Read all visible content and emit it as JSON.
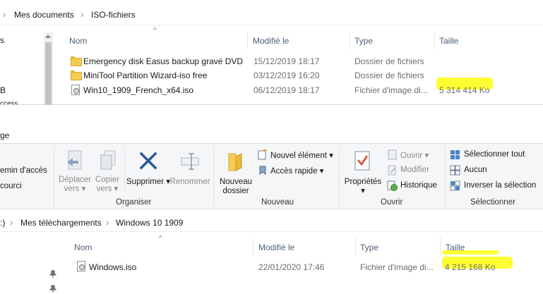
{
  "top": {
    "breadcrumb_sep": "›",
    "breadcrumb": [
      "Mes documents",
      "ISO-fichiers"
    ],
    "left_fragments": [
      "s",
      "B",
      "ccess"
    ],
    "columns": [
      "Nom",
      "Modifié le",
      "Type",
      "Taille"
    ],
    "rows": [
      {
        "name": "Emergency disk Easus backup gravé DVD",
        "modified": "15/12/2019 18:17",
        "type": "Dossier de fichiers",
        "size": "",
        "icon": "folder-icon"
      },
      {
        "name": "MiniTool Partition Wizard-iso free",
        "modified": "03/12/2019 16:20",
        "type": "Dossier de fichiers",
        "size": "",
        "icon": "folder-icon"
      },
      {
        "name": "Win10_1909_French_x64.iso",
        "modified": "06/12/2019 18:17",
        "type": "Fichier d'image di...",
        "size": "5 314 414 Ko",
        "icon": "disc-image-icon"
      }
    ]
  },
  "ribbon": {
    "tab_fragment": "ge",
    "left_items": [
      "emin d'accès",
      "courci"
    ],
    "organiser": {
      "deplacer": [
        "Déplacer",
        "vers ▾"
      ],
      "copier": [
        "Copier",
        "vers ▾"
      ],
      "supprimer": "Supprimer ▾",
      "renommer": "Renommer",
      "label": "Organiser"
    },
    "nouveau": {
      "dossier": [
        "Nouveau",
        "dossier"
      ],
      "element": "Nouvel élément ▾",
      "acces": "Accès rapide ▾",
      "label": "Nouveau"
    },
    "ouvrir": {
      "proprietes": [
        "Propriétés",
        "▾"
      ],
      "ouvrir": "Ouvrir ▾",
      "modifier": "Modifier",
      "historique": "Historique",
      "label": "Ouvrir"
    },
    "selectionner": {
      "tout": "Sélectionner tout",
      "aucun": "Aucun",
      "inverser": "Inverser la sélection",
      "label": "Sélectionner"
    }
  },
  "bottom": {
    "breadcrumb_prefix": ":)",
    "breadcrumb_sep": "›",
    "breadcrumb": [
      "Mes téléchargements",
      "Windows 10 1909"
    ],
    "columns": [
      "Nom",
      "Modifié le",
      "Type",
      "Taille"
    ],
    "rows": [
      {
        "name": "Windows.iso",
        "modified": "22/01/2020 17:46",
        "type": "Fichier d'image di...",
        "size": "4 215 168 Ko",
        "icon": "disc-image-icon"
      }
    ]
  },
  "colors": {
    "highlight": "#fdff32",
    "ribbon_bg": "#f5f6f7",
    "header_text": "#4c607a",
    "delete_x": "#2b579a"
  }
}
